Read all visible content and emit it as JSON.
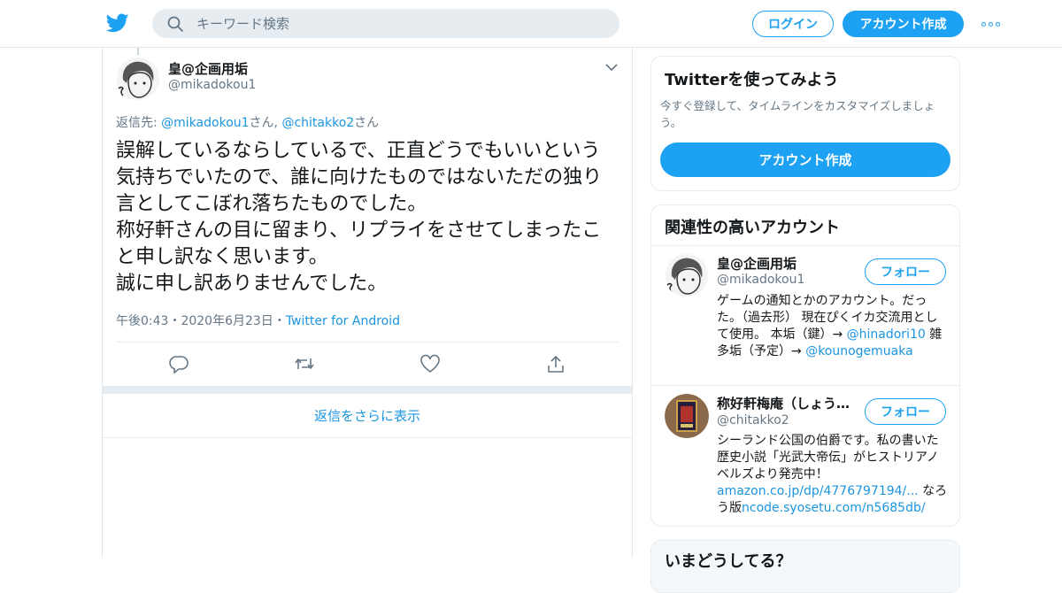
{
  "header": {
    "search_placeholder": "キーワード検索",
    "login_label": "ログイン",
    "signup_label": "アカウント作成",
    "brand_color": "#1da1f2"
  },
  "tweet": {
    "display_name": "皇@企画用垢",
    "handle": "@mikadokou1",
    "reply_prefix": "返信先: ",
    "reply_user1": "@mikadokou1",
    "reply_suffix1": "さん, ",
    "reply_user2": "@chitakko2",
    "reply_suffix2": "さん",
    "text": "誤解しているならしているで、正直どうでもいいという気持ちでいたので、誰に向けたものではないただの独り言としてこぼれ落ちたものでした。\n称好軒さんの目に留まり、リプライをさせてしまったこと申し訳なく思います。\n誠に申し訳ありませんでした。",
    "time": "午後0:43",
    "sep": "・",
    "date": "2020年6月23日",
    "source": "Twitter for Android",
    "actions": [
      "reply",
      "retweet",
      "like",
      "share"
    ]
  },
  "more_replies_label": "返信をさらに表示",
  "sidebar": {
    "signup_card": {
      "title": "Twitterを使ってみよう",
      "subtitle": "今すぐ登録して、タイムラインをカスタマイズしましょう。",
      "button_label": "アカウント作成"
    },
    "related": {
      "title": "関連性の高いアカウント",
      "follow_label": "フォロー",
      "accounts": [
        {
          "name": "皇@企画用垢",
          "handle": "@mikadokou1",
          "bio_text": "ゲームの通知とかのアカウント。だった。（過去形） 現在ぴくイカ交流用として使用。 本垢（鍵）→ ",
          "bio_link1": "@hinadori10",
          "bio_mid": " 雑多垢（予定）→ ",
          "bio_link2": "@kounogemuaka"
        },
        {
          "name": "称好軒梅庵（しょうこうけんばいあん）",
          "handle": "@chitakko2",
          "bio_text": "シーランド公国の伯爵です。私の書いた歴史小説「光武大帝伝」がヒストリアノベルズより発売中！ ",
          "bio_link1": "amazon.co.jp/dp/4776797194/...",
          "bio_mid": " なろう版",
          "bio_link2": "ncode.syosetu.com/n5685db/"
        }
      ]
    },
    "trends_title": "いまどうしてる？"
  }
}
